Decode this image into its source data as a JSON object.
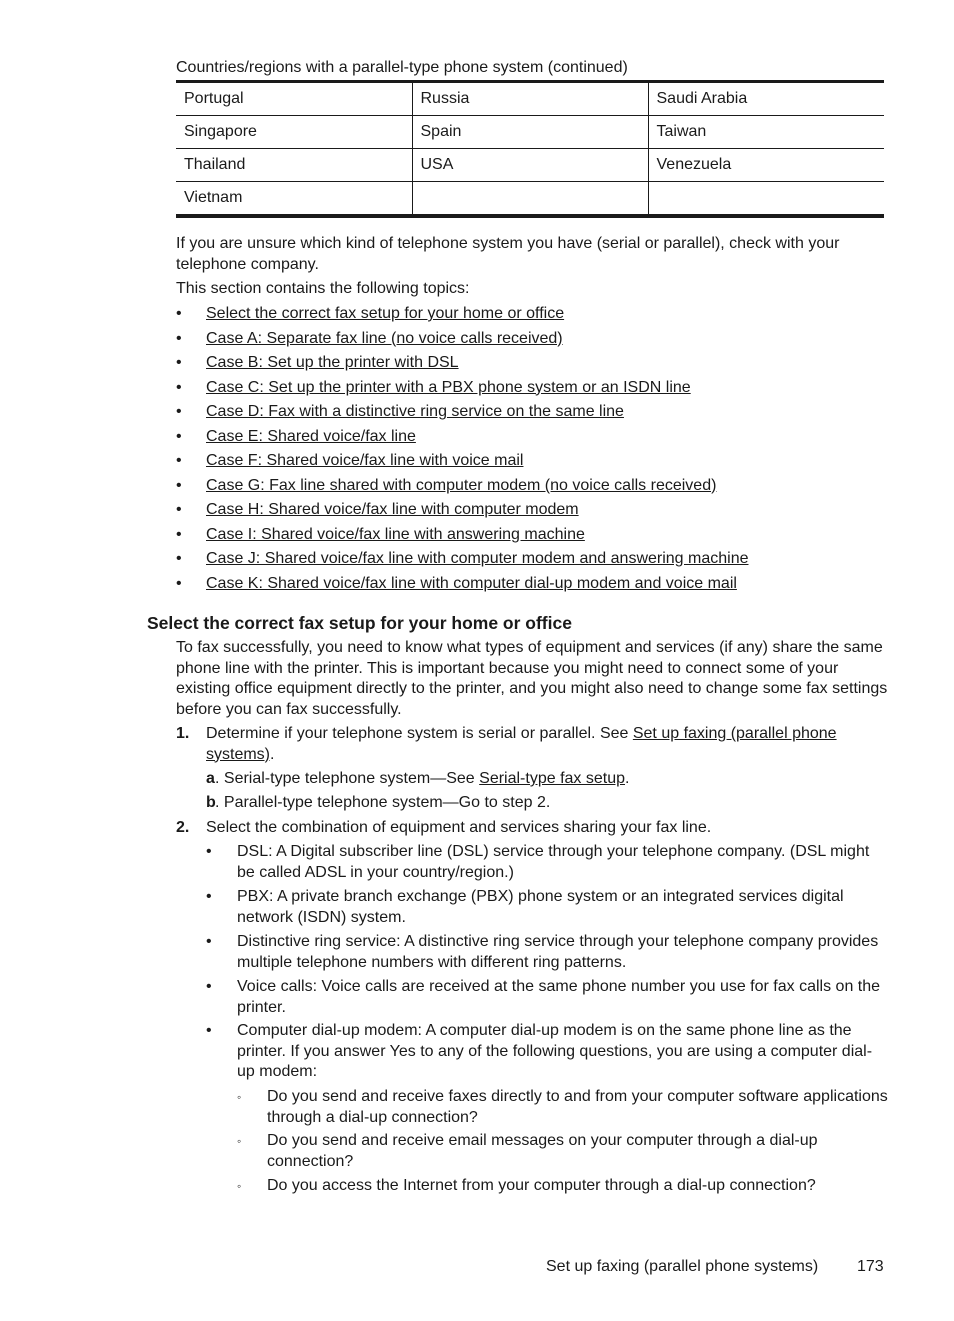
{
  "table": {
    "caption": "Countries/regions with a parallel-type phone system (continued)",
    "rows": [
      [
        "Portugal",
        "Russia",
        "Saudi Arabia"
      ],
      [
        "Singapore",
        "Spain",
        "Taiwan"
      ],
      [
        "Thailand",
        "USA",
        "Venezuela"
      ],
      [
        "Vietnam",
        "",
        ""
      ]
    ]
  },
  "intro": {
    "unsure": "If you are unsure which kind of telephone system you have (serial or parallel), check with your telephone company.",
    "topics_intro": "This section contains the following topics:",
    "bullet": "•",
    "topics": [
      "Select the correct fax setup for your home or office",
      "Case A: Separate fax line (no voice calls received)",
      "Case B: Set up the printer with DSL",
      "Case C: Set up the printer with a PBX phone system or an ISDN line",
      "Case D: Fax with a distinctive ring service on the same line",
      "Case E: Shared voice/fax line",
      "Case F: Shared voice/fax line with voice mail",
      "Case G: Fax line shared with computer modem (no voice calls received)",
      "Case H: Shared voice/fax line with computer modem",
      "Case I: Shared voice/fax line with answering machine",
      "Case J: Shared voice/fax line with computer modem and answering machine",
      "Case K: Shared voice/fax line with computer dial-up modem and voice mail"
    ]
  },
  "section": {
    "heading": "Select the correct fax setup for your home or office",
    "body": "To fax successfully, you need to know what types of equipment and services (if any) share the same phone line with the printer. This is important because you might need to connect some of your existing office equipment directly to the printer, and you might also need to change some fax settings before you can fax successfully.",
    "step1": {
      "num": "1.",
      "text_before": "Determine if your telephone system is serial or parallel. See ",
      "link": "Set up faxing (parallel phone systems)",
      "text_after": ".",
      "a": {
        "num": "a",
        "text_before": ". Serial-type telephone system—See ",
        "link": "Serial-type fax setup",
        "text_after": "."
      },
      "b": {
        "num": "b",
        "text": ". Parallel-type telephone system—Go to step 2."
      }
    },
    "step2": {
      "num": "2.",
      "text": "Select the combination of equipment and services sharing your fax line.",
      "items": [
        "DSL: A Digital subscriber line (DSL) service through your telephone company. (DSL might be called ADSL in your country/region.)",
        "PBX: A private branch exchange (PBX) phone system or an integrated services digital network (ISDN) system.",
        "Distinctive ring service: A distinctive ring service through your telephone company provides multiple telephone numbers with different ring patterns.",
        "Voice calls: Voice calls are received at the same phone number you use for fax calls on the printer.",
        "Computer dial-up modem: A computer dial-up modem is on the same phone line as the printer. If you answer Yes to any of the following questions, you are using a computer dial-up modem:"
      ],
      "subbullet": "◦",
      "questions": [
        "Do you send and receive faxes directly to and from your computer software applications through a dial-up connection?",
        "Do you send and receive email messages on your computer through a dial-up connection?",
        "Do you access the Internet from your computer through a dial-up connection?"
      ]
    }
  },
  "footer": {
    "title": "Set up faxing (parallel phone systems)",
    "page": "173"
  }
}
